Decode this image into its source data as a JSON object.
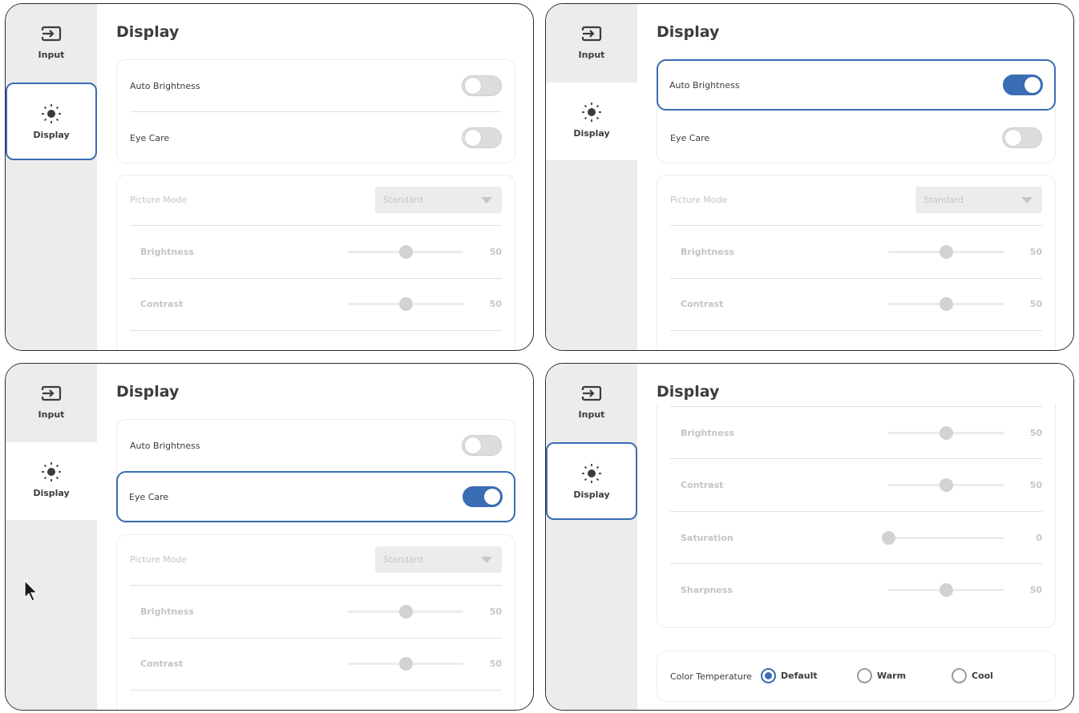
{
  "sidebar": {
    "input_label": "Input",
    "display_label": "Display",
    "input_icon": "input-icon",
    "display_icon": "brightness-icon"
  },
  "page": {
    "title": "Display"
  },
  "settings": {
    "auto_brightness": "Auto Brightness",
    "eye_care": "Eye Care",
    "picture_mode": "Picture Mode",
    "picture_mode_value": "Standard",
    "brightness": "Brightness",
    "brightness_value": "50",
    "brightness_level": 50,
    "contrast": "Contrast",
    "contrast_value": "50",
    "contrast_level": 50,
    "saturation": "Saturation",
    "saturation_value": "0",
    "saturation_level": 0,
    "sharpness": "Sharpness",
    "sharpness_value": "50",
    "sharpness_level": 50,
    "color_temperature": "Color Temperature",
    "temp_default": "Default",
    "temp_warm": "Warm",
    "temp_cool": "Cool"
  },
  "states": {
    "panel1": {
      "auto_brightness_on": false,
      "eye_care_on": false,
      "focus": "display-nav"
    },
    "panel2": {
      "auto_brightness_on": true,
      "eye_care_on": false,
      "focus": "auto-brightness"
    },
    "panel3": {
      "auto_brightness_on": false,
      "eye_care_on": true,
      "focus": "eye-care"
    },
    "panel4": {
      "color_temperature_selected": "Default",
      "focus": "display-nav"
    }
  },
  "colors": {
    "accent": "#3a6db3",
    "sidebar_bg": "#ececec",
    "disabled_text": "#c4c4c4"
  }
}
